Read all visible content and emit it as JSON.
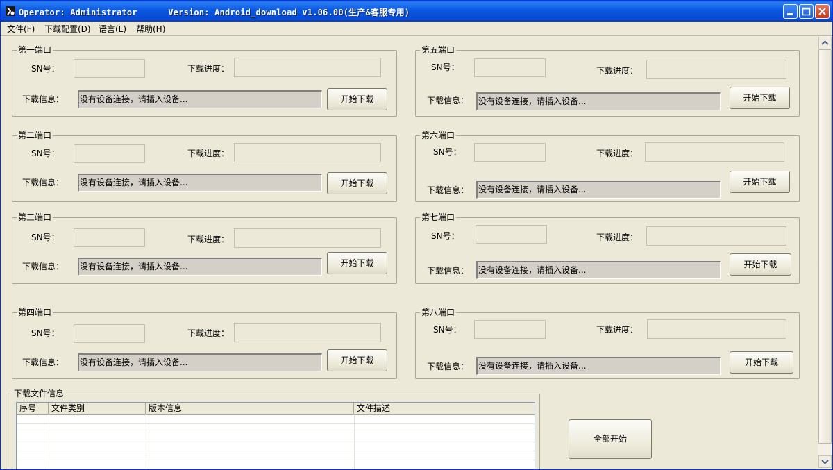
{
  "window": {
    "title": "Operator: Administrator      Version: Android_download v1.06.00(生产&客服专用)"
  },
  "menu": {
    "file": "文件(F)",
    "download_config": "下载配置(D)",
    "language": "语言(L)",
    "help": "帮助(H)"
  },
  "labels": {
    "sn": "SN号：",
    "progress": "下载进度：",
    "info": "下载信息："
  },
  "ports": [
    {
      "title": "第一端口",
      "info": "没有设备连接，请插入设备...",
      "button": "开始下载"
    },
    {
      "title": "第二端口",
      "info": "没有设备连接，请插入设备...",
      "button": "开始下载"
    },
    {
      "title": "第三端口",
      "info": "没有设备连接，请插入设备...",
      "button": "开始下载"
    },
    {
      "title": "第四端口",
      "info": "没有设备连接，请插入设备...",
      "button": "开始下载"
    },
    {
      "title": "第五端口",
      "info": "没有设备连接，请插入设备...",
      "button": "开始下载"
    },
    {
      "title": "第六端口",
      "info": "没有设备连接，请插入设备...",
      "button": "开始下载"
    },
    {
      "title": "第七端口",
      "info": "没有设备连接，请插入设备...",
      "button": "开始下载"
    },
    {
      "title": "第八端口",
      "info": "没有设备连接，请插入设备...",
      "button": "开始下载"
    }
  ],
  "file_info": {
    "title": "下载文件信息",
    "columns": [
      "序号",
      "文件类别",
      "版本信息",
      "文件描述"
    ]
  },
  "start_all": "全部开始"
}
